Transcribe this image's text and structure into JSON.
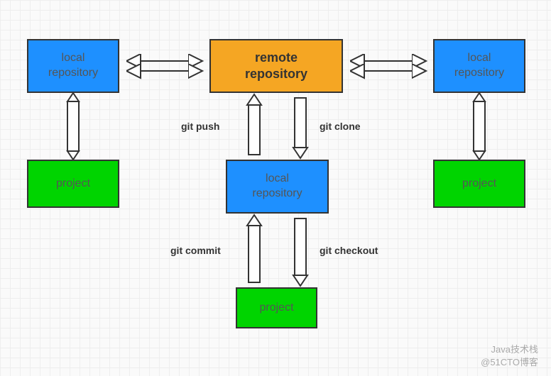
{
  "nodes": {
    "remote": "remote\nrepository",
    "local_left": "local\nrepository",
    "local_right": "local\nrepository",
    "local_center": "local\nrepository",
    "project_left": "project",
    "project_right": "project",
    "project_center": "project"
  },
  "edges": {
    "push": "git push",
    "clone": "git clone",
    "commit": "git commit",
    "checkout": "git checkout"
  },
  "watermark": {
    "line1": "Java技术栈",
    "line2": "@51CTO博客"
  },
  "colors": {
    "blue": "#1e90ff",
    "orange": "#f5a623",
    "green": "#00d400"
  }
}
